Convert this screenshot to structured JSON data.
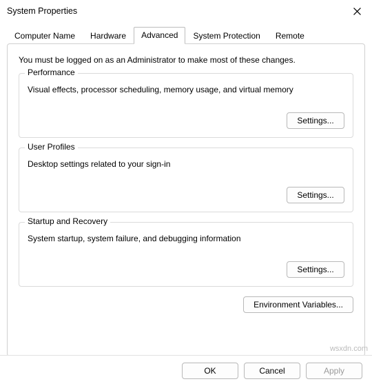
{
  "window": {
    "title": "System Properties"
  },
  "tabs": [
    {
      "label": "Computer Name"
    },
    {
      "label": "Hardware"
    },
    {
      "label": "Advanced"
    },
    {
      "label": "System Protection"
    },
    {
      "label": "Remote"
    }
  ],
  "intro": "You must be logged on as an Administrator to make most of these changes.",
  "groups": {
    "performance": {
      "legend": "Performance",
      "desc": "Visual effects, processor scheduling, memory usage, and virtual memory",
      "button": "Settings..."
    },
    "userProfiles": {
      "legend": "User Profiles",
      "desc": "Desktop settings related to your sign-in",
      "button": "Settings..."
    },
    "startup": {
      "legend": "Startup and Recovery",
      "desc": "System startup, system failure, and debugging information",
      "button": "Settings..."
    }
  },
  "envButton": "Environment Variables...",
  "footer": {
    "ok": "OK",
    "cancel": "Cancel",
    "apply": "Apply"
  },
  "watermark": "wsxdn.com"
}
